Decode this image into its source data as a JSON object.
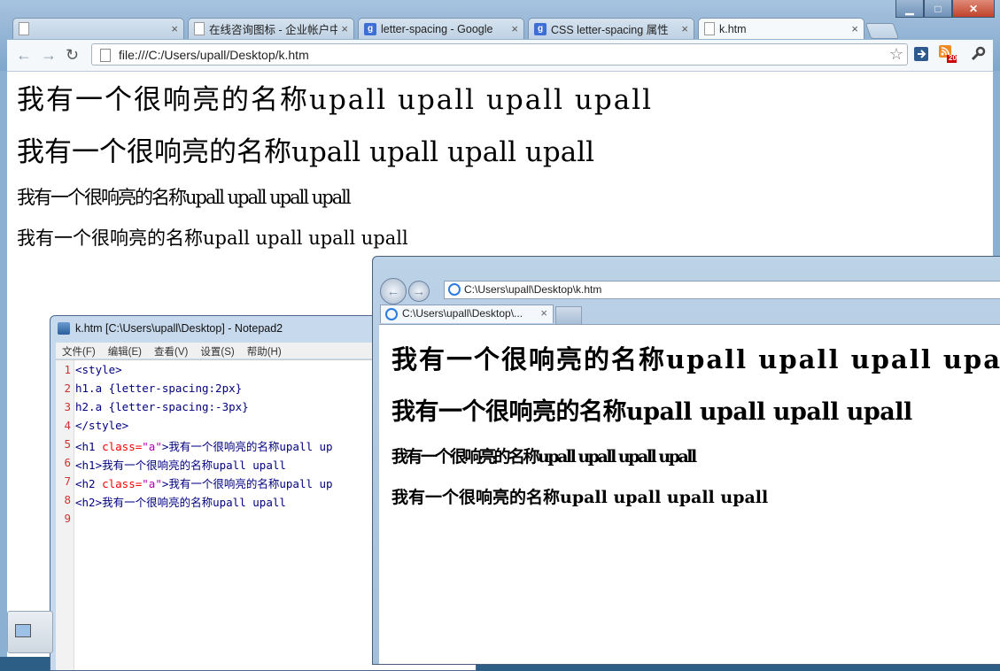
{
  "chrome": {
    "window_controls": {
      "minimize": "▁",
      "maximize": "□",
      "close": "✕"
    },
    "tabs": [
      {
        "label": "",
        "icon": "page-icon",
        "close": "×"
      },
      {
        "label": "在线咨询图标 - 企业帐户中",
        "icon": "page-icon",
        "close": "×"
      },
      {
        "label": "letter-spacing - Google",
        "icon": "google-icon",
        "close": "×"
      },
      {
        "label": "CSS letter-spacing 属性",
        "icon": "google-icon",
        "close": "×"
      },
      {
        "label": "k.htm",
        "icon": "page-icon",
        "close": "×",
        "active": true
      }
    ],
    "url": "file:///C:/Users/upall/Desktop/k.htm",
    "badge_count": "20",
    "content": [
      "我有一个很响亮的名称upall upall upall upall",
      "我有一个很响亮的名称upall upall upall upall",
      "我有一个很响亮的名称upall upall upall upall",
      "我有一个很响亮的名称upall upall upall upall"
    ]
  },
  "notepad": {
    "title": "k.htm [C:\\Users\\upall\\Desktop] - Notepad2",
    "menu": [
      "文件(F)",
      "编辑(E)",
      "查看(V)",
      "设置(S)",
      "帮助(H)"
    ],
    "lines": [
      {
        "n": "1",
        "tag": "<style>",
        "attr": "",
        "str": "",
        "rest": ""
      },
      {
        "n": "2",
        "tag": "h1.a {letter-spacing:2px}",
        "attr": "",
        "str": "",
        "rest": ""
      },
      {
        "n": "3",
        "tag": "h2.a {letter-spacing:-3px}",
        "attr": "",
        "str": "",
        "rest": ""
      },
      {
        "n": "4",
        "tag": "</style>",
        "attr": "",
        "str": "",
        "rest": ""
      },
      {
        "n": "5",
        "tag": "<h1 ",
        "attr": "class=",
        "str": "\"a\"",
        "rest": ">我有一个很响亮的名称upall up"
      },
      {
        "n": "6",
        "tag": "<h1>",
        "attr": "",
        "str": "",
        "rest": "我有一个很响亮的名称upall upall"
      },
      {
        "n": "7",
        "tag": "<h2 ",
        "attr": "class=",
        "str": "\"a\"",
        "rest": ">我有一个很响亮的名称upall up"
      },
      {
        "n": "8",
        "tag": "<h2>",
        "attr": "",
        "str": "",
        "rest": "我有一个很响亮的名称upall upall"
      },
      {
        "n": "9",
        "tag": "",
        "attr": "",
        "str": "",
        "rest": ""
      }
    ]
  },
  "ie": {
    "address": "C:\\Users\\upall\\Desktop\\k.htm",
    "tab_label": "C:\\Users\\upall\\Desktop\\...",
    "tab_close": "×",
    "content": [
      "我有一个很响亮的名称upall upall upall upall",
      "我有一个很响亮的名称upall upall upall upall",
      "我有一个很响亮的名称upall upall upall upall",
      "我有一个很响亮的名称upall upall upall upall"
    ]
  }
}
